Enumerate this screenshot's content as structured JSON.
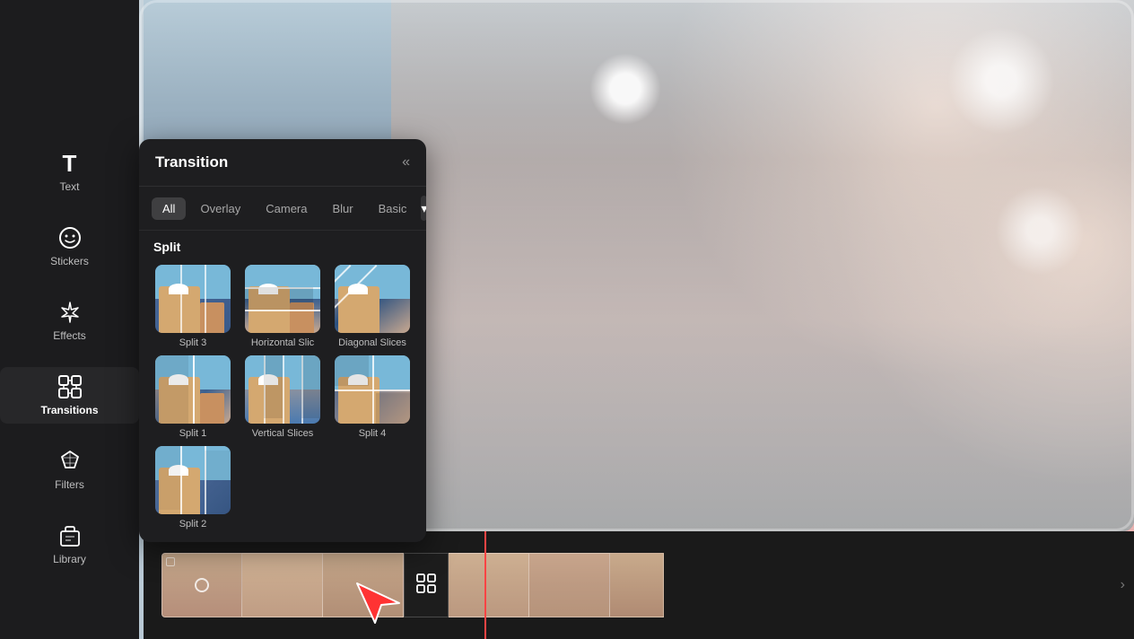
{
  "background": {
    "gradient_from": "#f8a0a0",
    "gradient_to": "#f4c0b0"
  },
  "sidebar": {
    "items": [
      {
        "id": "text",
        "label": "Text",
        "icon": "T",
        "active": false
      },
      {
        "id": "stickers",
        "label": "Stickers",
        "icon": "◎",
        "active": false
      },
      {
        "id": "effects",
        "label": "Effects",
        "icon": "✦",
        "active": false
      },
      {
        "id": "transitions",
        "label": "Transitions",
        "icon": "⊠",
        "active": true
      },
      {
        "id": "filters",
        "label": "Filters",
        "icon": "⬡",
        "active": false
      },
      {
        "id": "library",
        "label": "Library",
        "icon": "⬡",
        "active": false
      }
    ]
  },
  "panel": {
    "title": "Transition",
    "close_icon": "«",
    "tabs": [
      {
        "label": "All",
        "active": true
      },
      {
        "label": "Overlay",
        "active": false
      },
      {
        "label": "Camera",
        "active": false
      },
      {
        "label": "Blur",
        "active": false
      },
      {
        "label": "Basic",
        "active": false
      }
    ],
    "more_label": "▾",
    "section": "Split",
    "effects": [
      {
        "id": "split3",
        "label": "Split 3",
        "type": "split3"
      },
      {
        "id": "hsplit",
        "label": "Horizontal Slic",
        "type": "hsplit"
      },
      {
        "id": "dslices",
        "label": "Diagonal Slices",
        "type": "dslices"
      },
      {
        "id": "split1",
        "label": "Split 1",
        "type": "split1"
      },
      {
        "id": "vslices",
        "label": "Vertical Slices",
        "type": "vslices"
      },
      {
        "id": "split4",
        "label": "Split 4",
        "type": "split4"
      },
      {
        "id": "split2",
        "label": "Split 2",
        "type": "split2"
      }
    ]
  },
  "timeline": {
    "clips": [
      {
        "id": "clip1"
      },
      {
        "id": "clip2"
      },
      {
        "id": "clip3"
      },
      {
        "id": "clip4"
      },
      {
        "id": "clip5"
      }
    ]
  }
}
